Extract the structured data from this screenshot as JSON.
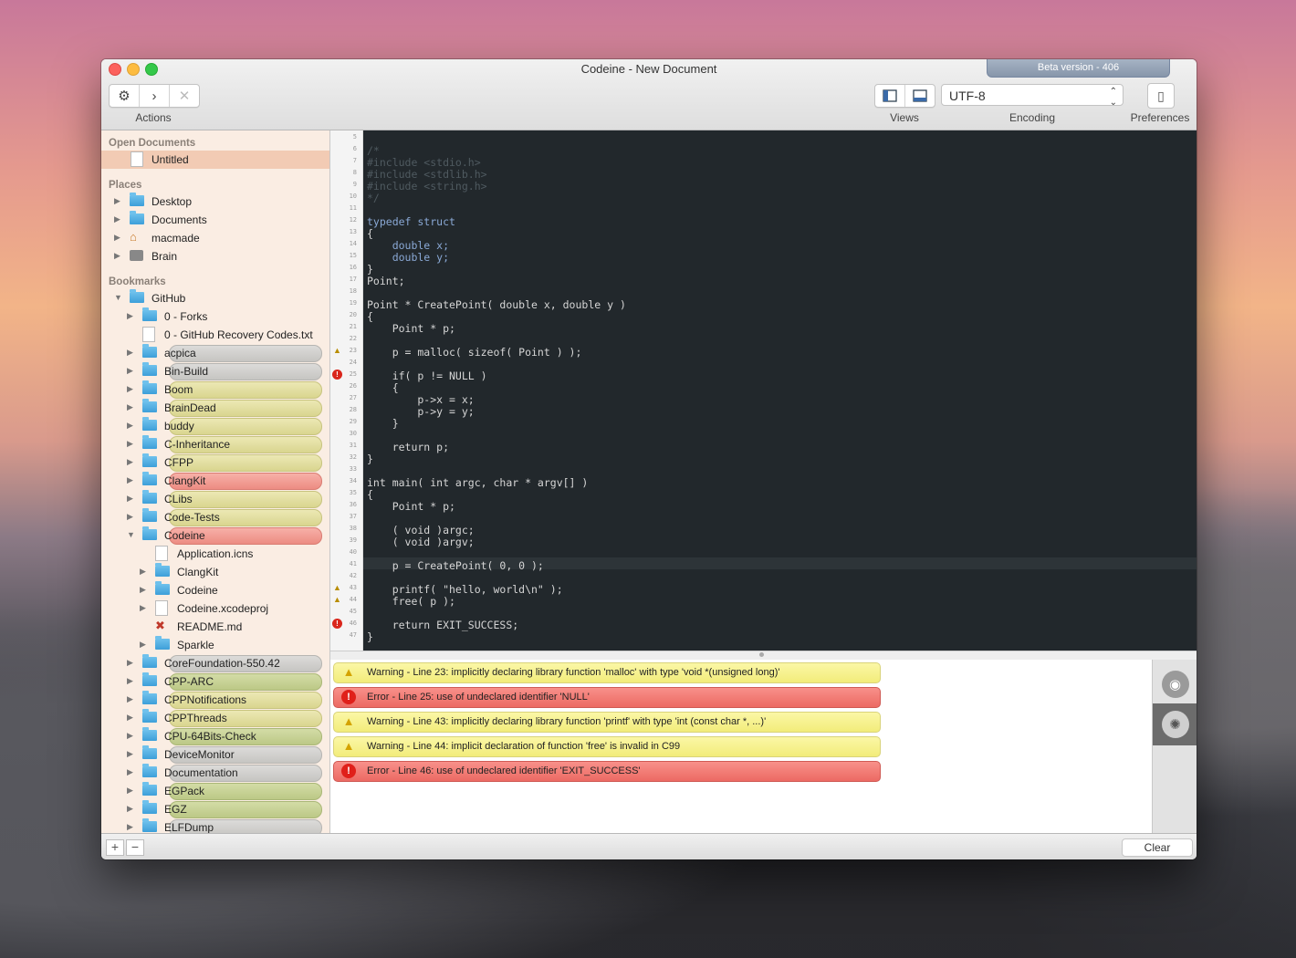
{
  "window": {
    "title": "Codeine - New Document",
    "beta_badge": "Beta version - 406"
  },
  "toolbar": {
    "actions_label": "Actions",
    "views_label": "Views",
    "encoding_label": "Encoding",
    "encoding_value": "UTF-8",
    "preferences_label": "Preferences"
  },
  "sidebar": {
    "open_documents_header": "Open Documents",
    "open_documents": [
      {
        "label": "Untitled"
      }
    ],
    "places_header": "Places",
    "places": [
      {
        "label": "Desktop"
      },
      {
        "label": "Documents"
      },
      {
        "label": "macmade"
      },
      {
        "label": "Brain"
      }
    ],
    "bookmarks_header": "Bookmarks",
    "bookmarks": [
      {
        "label": "GitHub"
      },
      {
        "label": "0 - Forks"
      },
      {
        "label": "0 - GitHub Recovery Codes.txt"
      },
      {
        "label": "acpica",
        "color": "gray"
      },
      {
        "label": "Bin-Build",
        "color": "gray"
      },
      {
        "label": "Boom",
        "color": "yellow"
      },
      {
        "label": "BrainDead",
        "color": "yellow"
      },
      {
        "label": "buddy",
        "color": "yellow"
      },
      {
        "label": "C-Inheritance",
        "color": "yellow"
      },
      {
        "label": "CFPP",
        "color": "yellow"
      },
      {
        "label": "ClangKit",
        "color": "red"
      },
      {
        "label": "CLibs",
        "color": "yellow"
      },
      {
        "label": "Code-Tests",
        "color": "yellow"
      },
      {
        "label": "Codeine",
        "color": "red"
      },
      {
        "label": "Application.icns"
      },
      {
        "label": "ClangKit"
      },
      {
        "label": "Codeine"
      },
      {
        "label": "Codeine.xcodeproj"
      },
      {
        "label": "README.md"
      },
      {
        "label": "Sparkle"
      },
      {
        "label": "CoreFoundation-550.42",
        "color": "gray"
      },
      {
        "label": "CPP-ARC",
        "color": "green"
      },
      {
        "label": "CPPNotifications",
        "color": "yellow"
      },
      {
        "label": "CPPThreads",
        "color": "yellow"
      },
      {
        "label": "CPU-64Bits-Check",
        "color": "green"
      },
      {
        "label": "DeviceMonitor",
        "color": "gray"
      },
      {
        "label": "Documentation",
        "color": "gray"
      },
      {
        "label": "EGPack",
        "color": "green"
      },
      {
        "label": "EGZ",
        "color": "green"
      },
      {
        "label": "ELFDump",
        "color": "gray"
      }
    ]
  },
  "editor": {
    "line_numbers": [
      "5",
      "6",
      "7",
      "8",
      "9",
      "10",
      "11",
      "12",
      "13",
      "14",
      "15",
      "16",
      "17",
      "18",
      "19",
      "20",
      "21",
      "22",
      "23",
      "24",
      "25",
      "26",
      "27",
      "28",
      "29",
      "30",
      "31",
      "32",
      "33",
      "34",
      "35",
      "36",
      "37",
      "38",
      "39",
      "40",
      "41",
      "42",
      "43",
      "44",
      "45",
      "46",
      "47"
    ],
    "code": {
      "c1": "/*",
      "c2": "#include <stdio.h>",
      "c3": "#include <stdlib.h>",
      "c4": "#include <string.h>",
      "c5": "*/",
      "l12": "typedef struct",
      "l13": "{",
      "l14": "    double x;",
      "l15": "    double y;",
      "l16": "}",
      "l17": "Point;",
      "l19": "Point * CreatePoint( double x, double y )",
      "l20": "{",
      "l21": "    Point * p;",
      "l23": "    p = malloc( sizeof( Point ) );",
      "l25": "    if( p != NULL )",
      "l26": "    {",
      "l27": "        p->x = x;",
      "l28": "        p->y = y;",
      "l29": "    }",
      "l31": "    return p;",
      "l32": "}",
      "l34": "int main( int argc, char * argv[] )",
      "l35": "{",
      "l36": "    Point * p;",
      "l38": "    ( void )argc;",
      "l39": "    ( void )argv;",
      "l41": "    p = CreatePoint( 0, 0 );",
      "l43": "    printf( \"hello, world\\n\" );",
      "l44": "    free( p );",
      "l46": "    return EXIT_SUCCESS;",
      "l47": "}"
    }
  },
  "issues": [
    {
      "type": "warning",
      "text": "Warning - Line 23: implicitly declaring library function 'malloc' with type 'void *(unsigned long)'"
    },
    {
      "type": "error",
      "text": "Error - Line 25: use of undeclared identifier 'NULL'"
    },
    {
      "type": "warning",
      "text": "Warning - Line 43: implicitly declaring library function 'printf' with type 'int (const char *, ...)'"
    },
    {
      "type": "warning",
      "text": "Warning - Line 44: implicit declaration of function 'free' is invalid in C99"
    },
    {
      "type": "error",
      "text": "Error - Line 46: use of undeclared identifier 'EXIT_SUCCESS'"
    }
  ],
  "bottom": {
    "add": "+",
    "remove": "−",
    "clear_label": "Clear"
  },
  "colors": {
    "keyword": "#8aa9d6",
    "string": "#e0a060",
    "comment": "#4f5a60",
    "number": "#9acd6a"
  }
}
